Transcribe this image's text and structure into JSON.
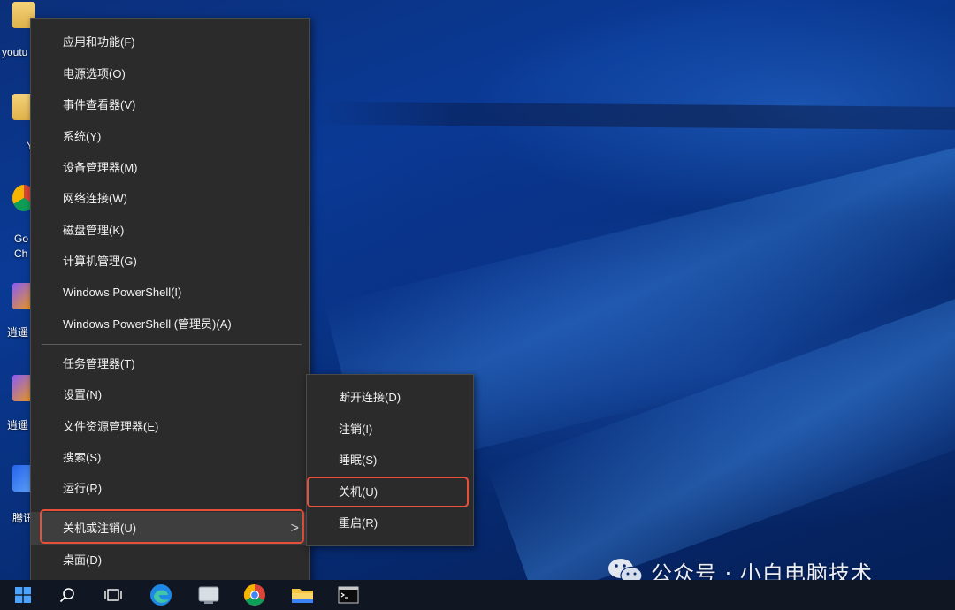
{
  "desktop": {
    "icons": [
      {
        "label": "youtu",
        "icon": "folder-icon"
      },
      {
        "label": "Y",
        "icon": "folder-icon"
      },
      {
        "label": "Go",
        "label2": "Ch",
        "icon": "chrome-shortcut-icon"
      },
      {
        "label": "逍遥",
        "icon": "app-shortcut-icon"
      },
      {
        "label": "逍遥",
        "icon": "app-shortcut-icon"
      },
      {
        "label": "腾讯",
        "icon": "app-shortcut-icon"
      }
    ]
  },
  "context_menu": {
    "group1": [
      {
        "label": "应用和功能(F)"
      },
      {
        "label": "电源选项(O)"
      },
      {
        "label": "事件查看器(V)"
      },
      {
        "label": "系统(Y)"
      },
      {
        "label": "设备管理器(M)"
      },
      {
        "label": "网络连接(W)"
      },
      {
        "label": "磁盘管理(K)"
      },
      {
        "label": "计算机管理(G)"
      },
      {
        "label": "Windows PowerShell(I)"
      },
      {
        "label": "Windows PowerShell (管理员)(A)"
      }
    ],
    "group2": [
      {
        "label": "任务管理器(T)"
      },
      {
        "label": "设置(N)"
      },
      {
        "label": "文件资源管理器(E)"
      },
      {
        "label": "搜索(S)"
      },
      {
        "label": "运行(R)"
      },
      {
        "label": "关机或注销(U)",
        "has_submenu": true,
        "highlighted": true
      },
      {
        "label": "桌面(D)"
      }
    ],
    "chevron": ">"
  },
  "shutdown_submenu": [
    {
      "label": "断开连接(D)"
    },
    {
      "label": "注销(I)"
    },
    {
      "label": "睡眠(S)"
    },
    {
      "label": "关机(U)",
      "highlighted": true
    },
    {
      "label": "重启(R)"
    }
  ],
  "taskbar": {
    "buttons": [
      "start-icon",
      "search-icon",
      "task-view-icon",
      "edge-icon",
      "app-icon",
      "chrome-icon",
      "file-explorer-icon",
      "terminal-icon"
    ]
  },
  "watermark": {
    "text": "公众号 · 小白电脑技术",
    "icon": "wechat-icon"
  },
  "colors": {
    "menu_bg": "#2b2b2b",
    "menu_text": "#f2f2f2",
    "highlight_border": "#e8503a",
    "taskbar_bg": "#101622"
  }
}
